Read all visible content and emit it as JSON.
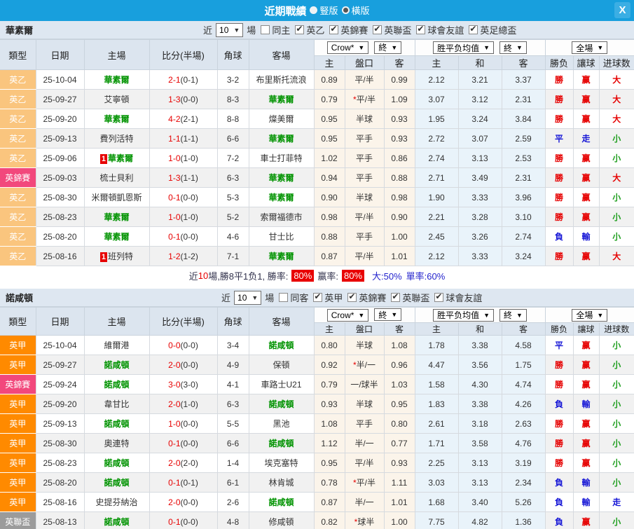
{
  "titlebar": {
    "title": "近期戰績",
    "radios": [
      {
        "label": "豎版",
        "selected": false
      },
      {
        "label": "橫版",
        "selected": true
      }
    ],
    "close_label": "X"
  },
  "colors": {
    "type_badges": {
      "英乙": "#FAC57E",
      "英甲": "#FF8A00",
      "英錦賽": "#F2487C",
      "英聯盃": "#9B9B9B"
    },
    "status": {
      "勝": "#E60000",
      "平": "#1515D6",
      "負": "#1515D6",
      "赢": "#E60000",
      "走": "#1515D6",
      "輸": "#1515D6",
      "大": "#E60000",
      "小": "#1E9E1E"
    }
  },
  "table_columns": {
    "type": "類型",
    "date": "日期",
    "home": "主場",
    "score": "比分(半場)",
    "corner": "角球",
    "away": "客場",
    "odds": [
      "主",
      "盤口",
      "客"
    ],
    "avg": [
      "主",
      "和",
      "客"
    ],
    "result": [
      "勝负",
      "讓球",
      "进球数"
    ]
  },
  "dropdowns": {
    "odds_source": "Crow*",
    "odds_time": "終",
    "avg_label": "胜平负均值",
    "avg_time": "終",
    "scope": "全場"
  },
  "sections": [
    {
      "team": "華素爾",
      "controls": {
        "near_label": "近",
        "count": "10",
        "games_label": "場",
        "same_label": "同主",
        "same_checked": false,
        "leagues": [
          {
            "label": "英乙",
            "checked": true
          },
          {
            "label": "英錦賽",
            "checked": true
          },
          {
            "label": "英聯盃",
            "checked": true
          },
          {
            "label": "球會友誼",
            "checked": true
          },
          {
            "label": "英足總盃",
            "checked": true
          }
        ]
      },
      "rows": [
        {
          "type": "英乙",
          "date": "25-10-04",
          "home": {
            "name": "華素爾",
            "hl": true,
            "badge": ""
          },
          "score": "2-1",
          "half": "(0-1)",
          "corner": "3-2",
          "away": {
            "name": "布里斯托流浪",
            "hl": false
          },
          "odds": {
            "home": "0.89",
            "handicap": "平/半",
            "star": false,
            "away": "0.99"
          },
          "avg": {
            "home": "2.12",
            "draw": "3.21",
            "away": "3.37"
          },
          "result": {
            "outcome": "勝",
            "handicap": "赢",
            "goals": "大"
          }
        },
        {
          "type": "英乙",
          "date": "25-09-27",
          "home": {
            "name": "艾寧頓",
            "hl": false,
            "badge": ""
          },
          "score": "1-3",
          "half": "(0-0)",
          "corner": "8-3",
          "away": {
            "name": "華素爾",
            "hl": true
          },
          "odds": {
            "home": "0.79",
            "handicap": "平/半",
            "star": true,
            "away": "1.09"
          },
          "avg": {
            "home": "3.07",
            "draw": "3.12",
            "away": "2.31"
          },
          "result": {
            "outcome": "勝",
            "handicap": "赢",
            "goals": "大"
          }
        },
        {
          "type": "英乙",
          "date": "25-09-20",
          "home": {
            "name": "華素爾",
            "hl": true,
            "badge": ""
          },
          "score": "4-2",
          "half": "(2-1)",
          "corner": "8-8",
          "away": {
            "name": "燦美爾",
            "hl": false
          },
          "odds": {
            "home": "0.95",
            "handicap": "半球",
            "star": false,
            "away": "0.93"
          },
          "avg": {
            "home": "1.95",
            "draw": "3.24",
            "away": "3.84"
          },
          "result": {
            "outcome": "勝",
            "handicap": "赢",
            "goals": "大"
          }
        },
        {
          "type": "英乙",
          "date": "25-09-13",
          "home": {
            "name": "費列活特",
            "hl": false,
            "badge": ""
          },
          "score": "1-1",
          "half": "(1-1)",
          "corner": "6-6",
          "away": {
            "name": "華素爾",
            "hl": true
          },
          "odds": {
            "home": "0.95",
            "handicap": "平手",
            "star": false,
            "away": "0.93"
          },
          "avg": {
            "home": "2.72",
            "draw": "3.07",
            "away": "2.59"
          },
          "result": {
            "outcome": "平",
            "handicap": "走",
            "goals": "小"
          }
        },
        {
          "type": "英乙",
          "date": "25-09-06",
          "home": {
            "name": "華素爾",
            "hl": true,
            "badge": "1"
          },
          "score": "1-0",
          "half": "(1-0)",
          "corner": "7-2",
          "away": {
            "name": "車士打菲特",
            "hl": false
          },
          "odds": {
            "home": "1.02",
            "handicap": "平手",
            "star": false,
            "away": "0.86"
          },
          "avg": {
            "home": "2.74",
            "draw": "3.13",
            "away": "2.53"
          },
          "result": {
            "outcome": "勝",
            "handicap": "赢",
            "goals": "小"
          }
        },
        {
          "type": "英錦賽",
          "date": "25-09-03",
          "home": {
            "name": "梳士貝利",
            "hl": false,
            "badge": ""
          },
          "score": "1-3",
          "half": "(1-1)",
          "corner": "6-3",
          "away": {
            "name": "華素爾",
            "hl": true
          },
          "odds": {
            "home": "0.94",
            "handicap": "平手",
            "star": false,
            "away": "0.88"
          },
          "avg": {
            "home": "2.71",
            "draw": "3.49",
            "away": "2.31"
          },
          "result": {
            "outcome": "勝",
            "handicap": "赢",
            "goals": "大"
          }
        },
        {
          "type": "英乙",
          "date": "25-08-30",
          "home": {
            "name": "米爾頓凱恩斯",
            "hl": false,
            "badge": ""
          },
          "score": "0-1",
          "half": "(0-0)",
          "corner": "5-3",
          "away": {
            "name": "華素爾",
            "hl": true
          },
          "odds": {
            "home": "0.90",
            "handicap": "半球",
            "star": false,
            "away": "0.98"
          },
          "avg": {
            "home": "1.90",
            "draw": "3.33",
            "away": "3.96"
          },
          "result": {
            "outcome": "勝",
            "handicap": "赢",
            "goals": "小"
          }
        },
        {
          "type": "英乙",
          "date": "25-08-23",
          "home": {
            "name": "華素爾",
            "hl": true,
            "badge": ""
          },
          "score": "1-0",
          "half": "(1-0)",
          "corner": "5-2",
          "away": {
            "name": "索爾福德市",
            "hl": false
          },
          "odds": {
            "home": "0.98",
            "handicap": "平/半",
            "star": false,
            "away": "0.90"
          },
          "avg": {
            "home": "2.21",
            "draw": "3.28",
            "away": "3.10"
          },
          "result": {
            "outcome": "勝",
            "handicap": "赢",
            "goals": "小"
          }
        },
        {
          "type": "英乙",
          "date": "25-08-20",
          "home": {
            "name": "華素爾",
            "hl": true,
            "badge": ""
          },
          "score": "0-1",
          "half": "(0-0)",
          "corner": "4-6",
          "away": {
            "name": "甘士比",
            "hl": false
          },
          "odds": {
            "home": "0.88",
            "handicap": "平手",
            "star": false,
            "away": "1.00"
          },
          "avg": {
            "home": "2.45",
            "draw": "3.26",
            "away": "2.74"
          },
          "result": {
            "outcome": "負",
            "handicap": "輸",
            "goals": "小"
          }
        },
        {
          "type": "英乙",
          "date": "25-08-16",
          "home": {
            "name": "班列特",
            "hl": false,
            "badge": "1"
          },
          "score": "1-2",
          "half": "(1-2)",
          "corner": "7-1",
          "away": {
            "name": "華素爾",
            "hl": true
          },
          "odds": {
            "home": "0.87",
            "handicap": "平/半",
            "star": false,
            "away": "1.01"
          },
          "avg": {
            "home": "2.12",
            "draw": "3.33",
            "away": "3.24"
          },
          "result": {
            "outcome": "勝",
            "handicap": "赢",
            "goals": "大"
          }
        }
      ],
      "summary": {
        "part1": "近",
        "num": "10",
        "part2": "場,勝8平1负1, 勝率:",
        "rate1": "80%",
        "part3": "赢率:",
        "rate2": "80%",
        "part4": "大:50%",
        "part5": "單率:60%"
      }
    },
    {
      "team": "諾咸頓",
      "controls": {
        "near_label": "近",
        "count": "10",
        "games_label": "場",
        "same_label": "同客",
        "same_checked": false,
        "leagues": [
          {
            "label": "英甲",
            "checked": true
          },
          {
            "label": "英錦賽",
            "checked": true
          },
          {
            "label": "英聯盃",
            "checked": true
          },
          {
            "label": "球會友誼",
            "checked": true
          }
        ]
      },
      "rows": [
        {
          "type": "英甲",
          "date": "25-10-04",
          "home": {
            "name": "維爾港",
            "hl": false,
            "badge": ""
          },
          "score": "0-0",
          "half": "(0-0)",
          "corner": "3-4",
          "away": {
            "name": "諾咸頓",
            "hl": true
          },
          "odds": {
            "home": "0.80",
            "handicap": "半球",
            "star": false,
            "away": "1.08"
          },
          "avg": {
            "home": "1.78",
            "draw": "3.38",
            "away": "4.58"
          },
          "result": {
            "outcome": "平",
            "handicap": "赢",
            "goals": "小"
          }
        },
        {
          "type": "英甲",
          "date": "25-09-27",
          "home": {
            "name": "諾咸頓",
            "hl": true,
            "badge": ""
          },
          "score": "2-0",
          "half": "(0-0)",
          "corner": "4-9",
          "away": {
            "name": "保頓",
            "hl": false
          },
          "odds": {
            "home": "0.92",
            "handicap": "半/一",
            "star": true,
            "away": "0.96"
          },
          "avg": {
            "home": "4.47",
            "draw": "3.56",
            "away": "1.75"
          },
          "result": {
            "outcome": "勝",
            "handicap": "赢",
            "goals": "小"
          }
        },
        {
          "type": "英錦賽",
          "date": "25-09-24",
          "home": {
            "name": "諾咸頓",
            "hl": true,
            "badge": ""
          },
          "score": "3-0",
          "half": "(3-0)",
          "corner": "4-1",
          "away": {
            "name": "車路士U21",
            "hl": false
          },
          "odds": {
            "home": "0.79",
            "handicap": "一/球半",
            "star": false,
            "away": "1.03"
          },
          "avg": {
            "home": "1.58",
            "draw": "4.30",
            "away": "4.74"
          },
          "result": {
            "outcome": "勝",
            "handicap": "赢",
            "goals": "小"
          }
        },
        {
          "type": "英甲",
          "date": "25-09-20",
          "home": {
            "name": "韋甘比",
            "hl": false,
            "badge": ""
          },
          "score": "2-0",
          "half": "(1-0)",
          "corner": "6-3",
          "away": {
            "name": "諾咸頓",
            "hl": true
          },
          "odds": {
            "home": "0.93",
            "handicap": "半球",
            "star": false,
            "away": "0.95"
          },
          "avg": {
            "home": "1.83",
            "draw": "3.38",
            "away": "4.26"
          },
          "result": {
            "outcome": "負",
            "handicap": "輸",
            "goals": "小"
          }
        },
        {
          "type": "英甲",
          "date": "25-09-13",
          "home": {
            "name": "諾咸頓",
            "hl": true,
            "badge": ""
          },
          "score": "1-0",
          "half": "(0-0)",
          "corner": "5-5",
          "away": {
            "name": "黑池",
            "hl": false
          },
          "odds": {
            "home": "1.08",
            "handicap": "平手",
            "star": false,
            "away": "0.80"
          },
          "avg": {
            "home": "2.61",
            "draw": "3.18",
            "away": "2.63"
          },
          "result": {
            "outcome": "勝",
            "handicap": "赢",
            "goals": "小"
          }
        },
        {
          "type": "英甲",
          "date": "25-08-30",
          "home": {
            "name": "奧連特",
            "hl": false,
            "badge": ""
          },
          "score": "0-1",
          "half": "(0-0)",
          "corner": "6-6",
          "away": {
            "name": "諾咸頓",
            "hl": true
          },
          "odds": {
            "home": "1.12",
            "handicap": "半/一",
            "star": false,
            "away": "0.77"
          },
          "avg": {
            "home": "1.71",
            "draw": "3.58",
            "away": "4.76"
          },
          "result": {
            "outcome": "勝",
            "handicap": "赢",
            "goals": "小"
          }
        },
        {
          "type": "英甲",
          "date": "25-08-23",
          "home": {
            "name": "諾咸頓",
            "hl": true,
            "badge": ""
          },
          "score": "2-0",
          "half": "(2-0)",
          "corner": "1-4",
          "away": {
            "name": "埃克塞特",
            "hl": false
          },
          "odds": {
            "home": "0.95",
            "handicap": "平/半",
            "star": false,
            "away": "0.93"
          },
          "avg": {
            "home": "2.25",
            "draw": "3.13",
            "away": "3.19"
          },
          "result": {
            "outcome": "勝",
            "handicap": "赢",
            "goals": "小"
          }
        },
        {
          "type": "英甲",
          "date": "25-08-20",
          "home": {
            "name": "諾咸頓",
            "hl": true,
            "badge": ""
          },
          "score": "0-1",
          "half": "(0-1)",
          "corner": "6-1",
          "away": {
            "name": "林肯城",
            "hl": false
          },
          "odds": {
            "home": "0.78",
            "handicap": "平/半",
            "star": true,
            "away": "1.11"
          },
          "avg": {
            "home": "3.03",
            "draw": "3.13",
            "away": "2.34"
          },
          "result": {
            "outcome": "負",
            "handicap": "輸",
            "goals": "小"
          }
        },
        {
          "type": "英甲",
          "date": "25-08-16",
          "home": {
            "name": "史提芬納治",
            "hl": false,
            "badge": ""
          },
          "score": "2-0",
          "half": "(0-0)",
          "corner": "2-6",
          "away": {
            "name": "諾咸頓",
            "hl": true
          },
          "odds": {
            "home": "0.87",
            "handicap": "半/一",
            "star": false,
            "away": "1.01"
          },
          "avg": {
            "home": "1.68",
            "draw": "3.40",
            "away": "5.26"
          },
          "result": {
            "outcome": "負",
            "handicap": "輸",
            "goals": "走"
          }
        },
        {
          "type": "英聯盃",
          "date": "25-08-13",
          "home": {
            "name": "諾咸頓",
            "hl": true,
            "badge": ""
          },
          "score": "0-1",
          "half": "(0-0)",
          "corner": "4-8",
          "away": {
            "name": "修咸頓",
            "hl": false
          },
          "odds": {
            "home": "0.82",
            "handicap": "球半",
            "star": true,
            "away": "1.00"
          },
          "avg": {
            "home": "7.75",
            "draw": "4.82",
            "away": "1.36"
          },
          "result": {
            "outcome": "負",
            "handicap": "赢",
            "goals": "小"
          }
        }
      ],
      "summary": null
    }
  ]
}
